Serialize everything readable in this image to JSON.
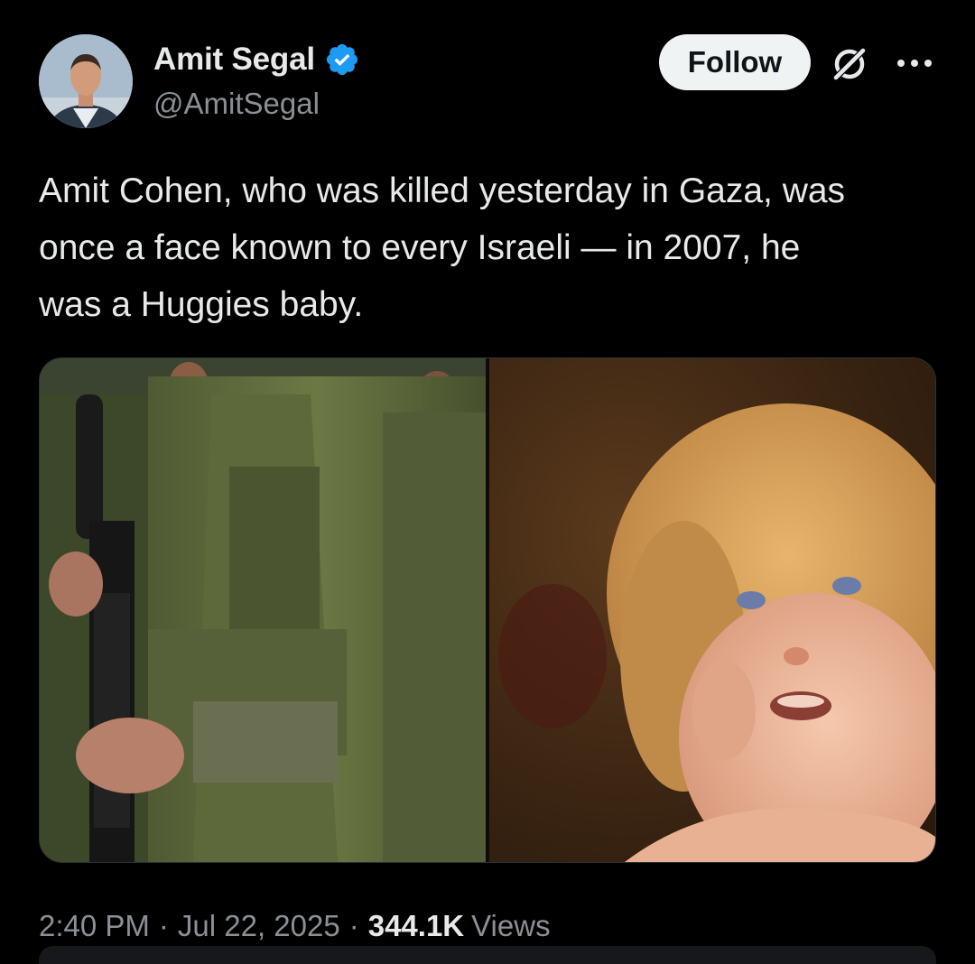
{
  "author": {
    "display_name": "Amit Segal",
    "handle": "@AmitSegal"
  },
  "actions": {
    "follow_label": "Follow"
  },
  "icons": {
    "verified": "verified-badge-icon",
    "grok": "grok-icon",
    "more": "more-options-icon"
  },
  "tweet": {
    "text": "Amit Cohen, who was killed yesterday in Gaza, was\nonce a face known to every Israeli — in 2007, he\nwas a Huggies baby."
  },
  "meta": {
    "time": "2:40 PM",
    "separator": "·",
    "date": "Jul 22, 2025",
    "views_count": "344.1K",
    "views_label": "Views"
  },
  "colors": {
    "background": "#000000",
    "text_primary": "#e7e9ea",
    "text_secondary": "#8b9096",
    "verified_blue": "#1d9bf0",
    "follow_bg": "#eff3f4"
  }
}
